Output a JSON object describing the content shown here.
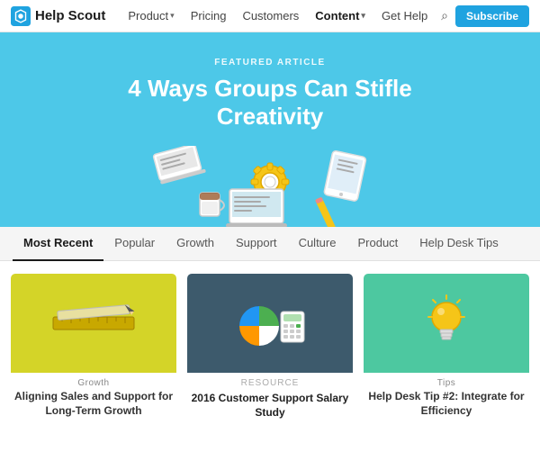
{
  "brand": {
    "name": "Help Scout",
    "logo_text": "Help Scout"
  },
  "nav": {
    "links": [
      {
        "label": "Product",
        "has_arrow": true,
        "active": false
      },
      {
        "label": "Pricing",
        "has_arrow": false,
        "active": false
      },
      {
        "label": "Customers",
        "has_arrow": false,
        "active": false
      },
      {
        "label": "Content",
        "has_arrow": true,
        "active": true
      },
      {
        "label": "Get Help",
        "has_arrow": false,
        "active": false
      }
    ],
    "subscribe_label": "Subscribe"
  },
  "hero": {
    "label": "Featured Article",
    "title": "4 Ways Groups Can Stifle Creativity"
  },
  "tabs": {
    "items": [
      {
        "label": "Most Recent",
        "active": true
      },
      {
        "label": "Popular",
        "active": false
      },
      {
        "label": "Growth",
        "active": false
      },
      {
        "label": "Support",
        "active": false
      },
      {
        "label": "Culture",
        "active": false
      },
      {
        "label": "Product",
        "active": false
      },
      {
        "label": "Help Desk Tips",
        "active": false
      }
    ]
  },
  "cards": [
    {
      "id": "card-1",
      "bg": "yellow",
      "category": "Growth",
      "title": "Aligning Sales and Support for Long-Term Growth"
    },
    {
      "id": "card-2",
      "bg": "dark-teal",
      "resource_label": "RESOURCE",
      "title": "2016 Customer Support Salary Study"
    },
    {
      "id": "card-3",
      "bg": "teal",
      "category": "Tips",
      "title": "Help Desk Tip #2: Integrate for Efficiency"
    }
  ]
}
